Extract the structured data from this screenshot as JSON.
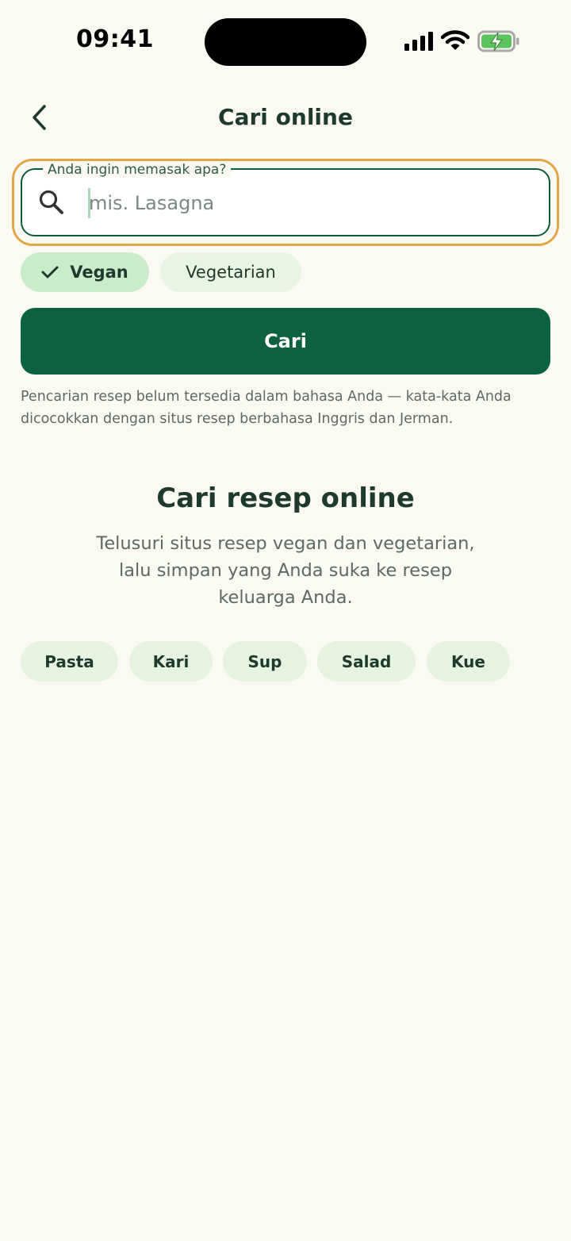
{
  "status_bar": {
    "time": "09:41"
  },
  "header": {
    "title": "Cari online",
    "back_icon": "chevron-left-icon"
  },
  "search": {
    "label": "Anda ingin memasak apa?",
    "placeholder": "mis. Lasagna",
    "value": "",
    "icon": "search-icon"
  },
  "filters": [
    {
      "label": "Vegan",
      "selected": true,
      "icon": "check-icon"
    },
    {
      "label": "Vegetarian",
      "selected": false
    }
  ],
  "search_button": {
    "label": "Cari"
  },
  "language_note": "Pencarian resep belum tersedia dalam bahasa Anda — kata-kata Anda dicocokkan dengan situs resep berbahasa Inggris dan Jerman.",
  "empty_state": {
    "title": "Cari resep online",
    "description": "Telusuri situs resep vegan dan vegetarian, lalu simpan yang Anda suka ke resep keluarga Anda."
  },
  "categories": [
    "Pasta",
    "Kari",
    "Sup",
    "Salad",
    "Kue"
  ],
  "colors": {
    "background": "#fbfaf2",
    "primary": "#0c6240",
    "chip_selected": "#cbecca",
    "chip": "#e6f4df",
    "focus_ring": "#e1a647"
  }
}
